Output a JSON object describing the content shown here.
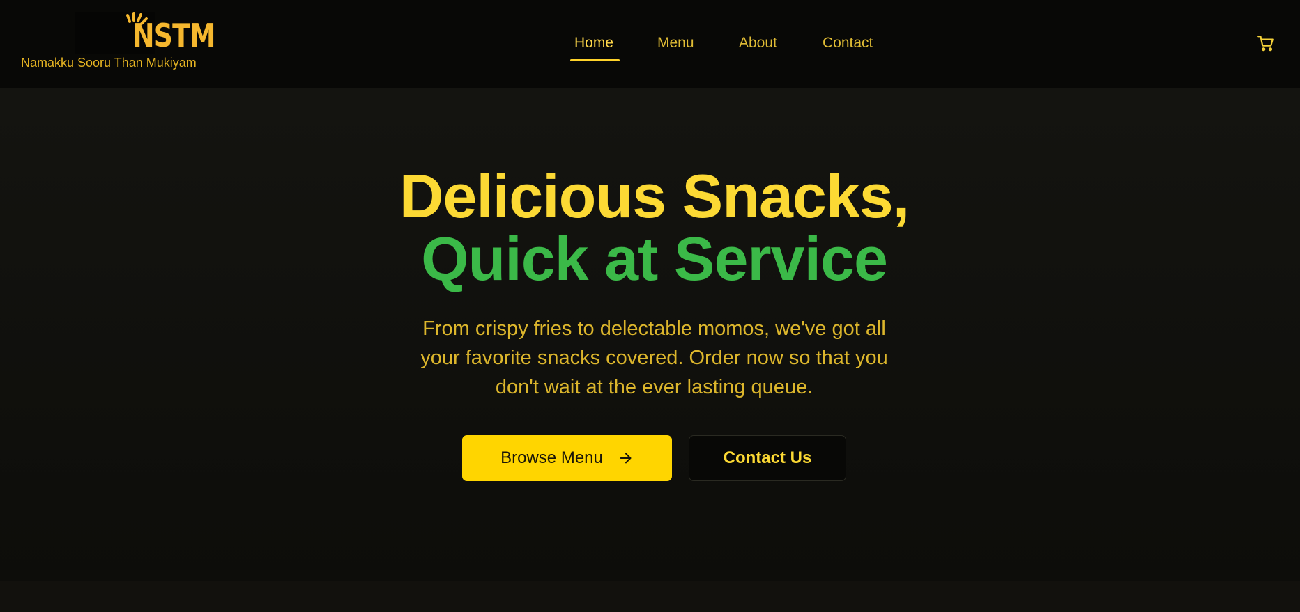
{
  "brand": {
    "logo_text": "NSTM",
    "tagline": "Namakku Sooru Than Mukiyam"
  },
  "nav": {
    "items": [
      {
        "label": "Home",
        "active": true
      },
      {
        "label": "Menu",
        "active": false
      },
      {
        "label": "About",
        "active": false
      },
      {
        "label": "Contact",
        "active": false
      }
    ],
    "cart_icon": "cart-icon"
  },
  "hero": {
    "title_line1": "Delicious Snacks,",
    "title_line2": "Quick at Service",
    "subtitle": "From crispy fries to delectable momos, we've got all your favorite snacks covered. Order now so that you don't wait at the ever lasting queue.",
    "primary_button": "Browse Menu",
    "primary_button_icon": "arrow-right-icon",
    "secondary_button": "Contact Us"
  },
  "colors": {
    "accent_yellow": "#ffd500",
    "title_yellow": "#fcd934",
    "title_green": "#3bb948",
    "text_gold": "#dcb62c",
    "background": "#0a0a08"
  }
}
